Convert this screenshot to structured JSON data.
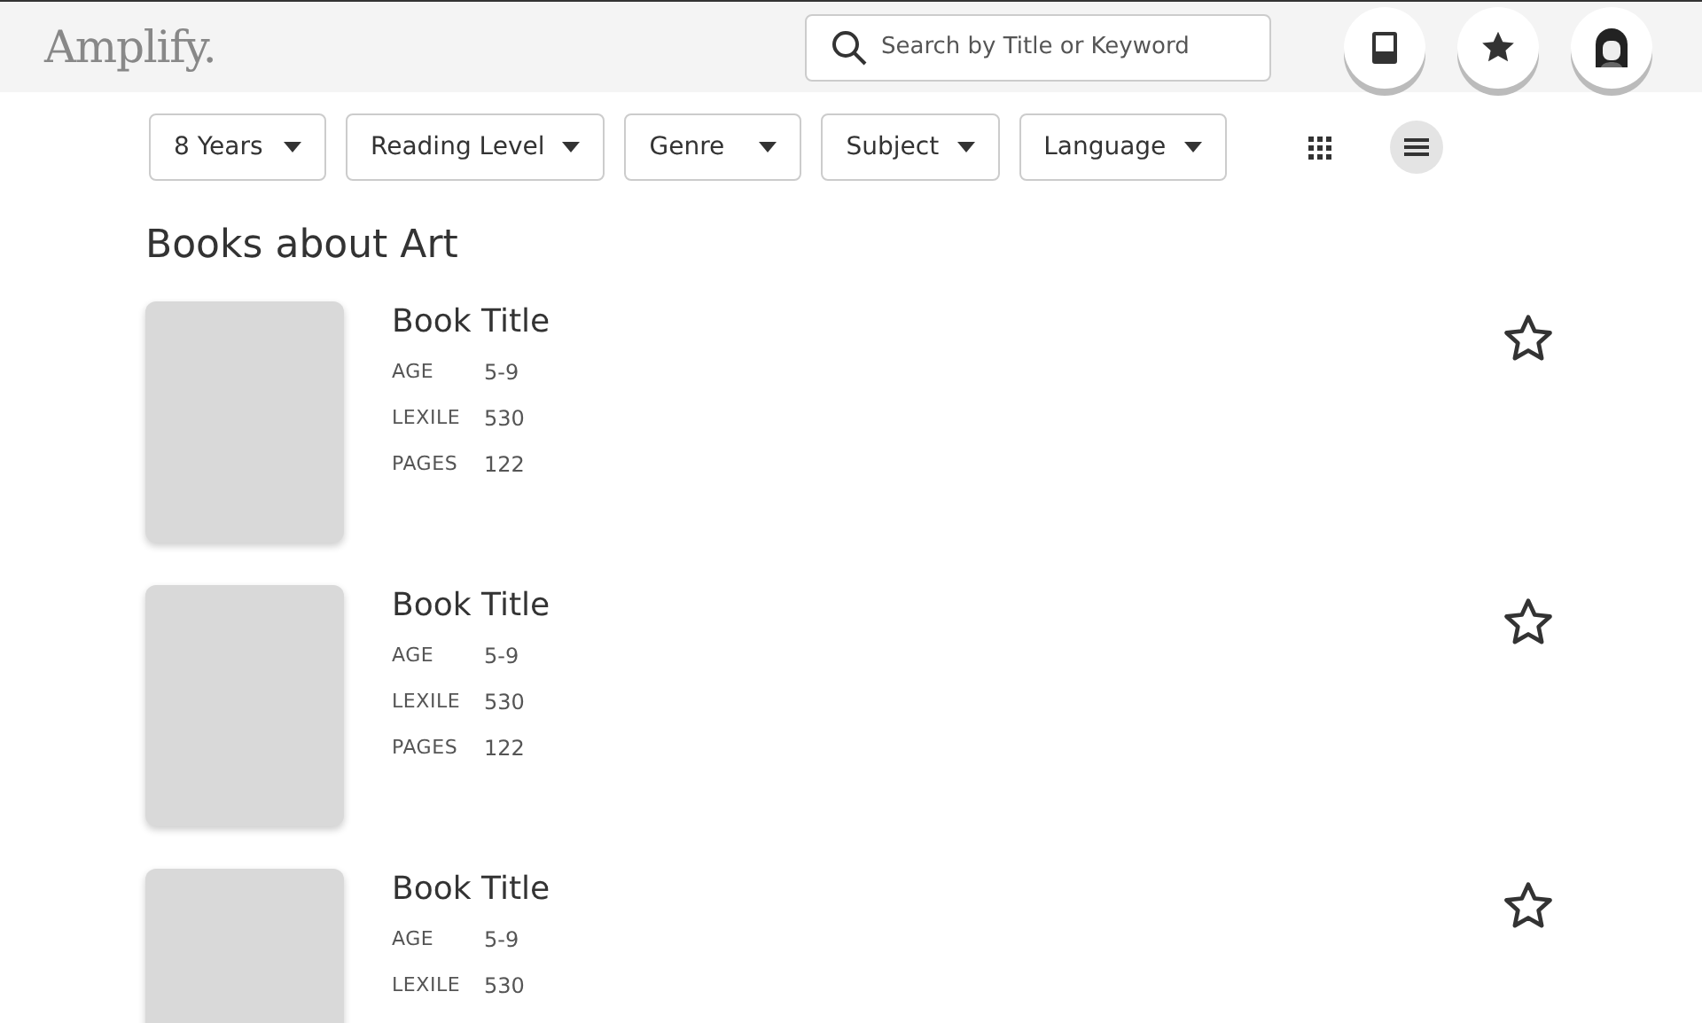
{
  "header": {
    "logo": "Amplify.",
    "search": {
      "placeholder": "Search by Title or Keyword"
    }
  },
  "filters": [
    {
      "label": "8 Years"
    },
    {
      "label": "Reading Level"
    },
    {
      "label": "Genre"
    },
    {
      "label": "Subject"
    },
    {
      "label": "Language"
    }
  ],
  "view_toggle": [
    {
      "kind": "grid",
      "selected": false
    },
    {
      "kind": "list",
      "selected": true
    }
  ],
  "section_title": "Books about Art",
  "books": [
    {
      "title": "Book Title",
      "favorite": false,
      "details": [
        {
          "label": "AGE",
          "value": "5-9"
        },
        {
          "label": "LEXILE",
          "value": "530"
        },
        {
          "label": "PAGES",
          "value": "122"
        }
      ]
    },
    {
      "title": "Book Title",
      "favorite": false,
      "details": [
        {
          "label": "AGE",
          "value": "5-9"
        },
        {
          "label": "LEXILE",
          "value": "530"
        },
        {
          "label": "PAGES",
          "value": "122"
        }
      ]
    },
    {
      "title": "Book Title",
      "favorite": false,
      "details": [
        {
          "label": "AGE",
          "value": "5-9"
        },
        {
          "label": "LEXILE",
          "value": "530"
        }
      ]
    }
  ]
}
